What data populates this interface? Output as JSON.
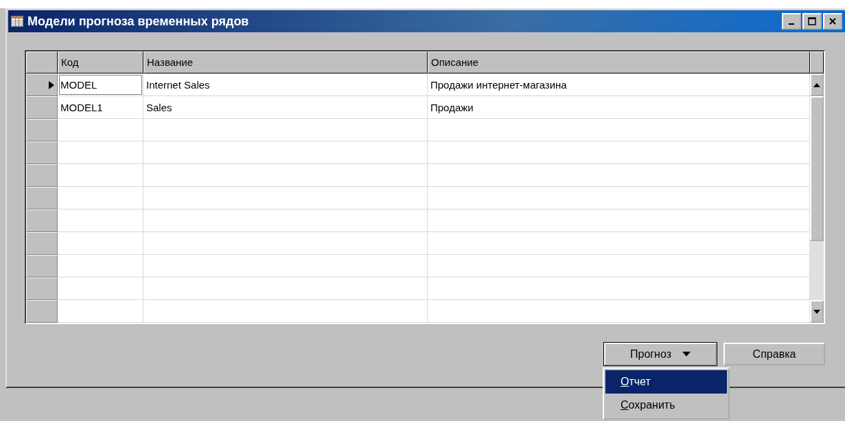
{
  "window": {
    "title": "Модели прогноза временных рядов"
  },
  "table": {
    "columns": [
      "Код",
      "Название",
      "Описание"
    ],
    "rows": [
      {
        "cells": [
          "MODEL",
          "Internet Sales",
          "Продажи интернет-магазина"
        ],
        "selected": true
      },
      {
        "cells": [
          "MODEL1",
          "Sales",
          "Продажи"
        ],
        "selected": false
      }
    ]
  },
  "buttons": [
    {
      "label": "Прогноз",
      "kind": "menu"
    },
    {
      "label": "Справка",
      "kind": "plain"
    }
  ],
  "menu": {
    "items": [
      {
        "label": "Отчет",
        "selected": true
      },
      {
        "label": "Сохранить",
        "selected": false
      }
    ]
  }
}
